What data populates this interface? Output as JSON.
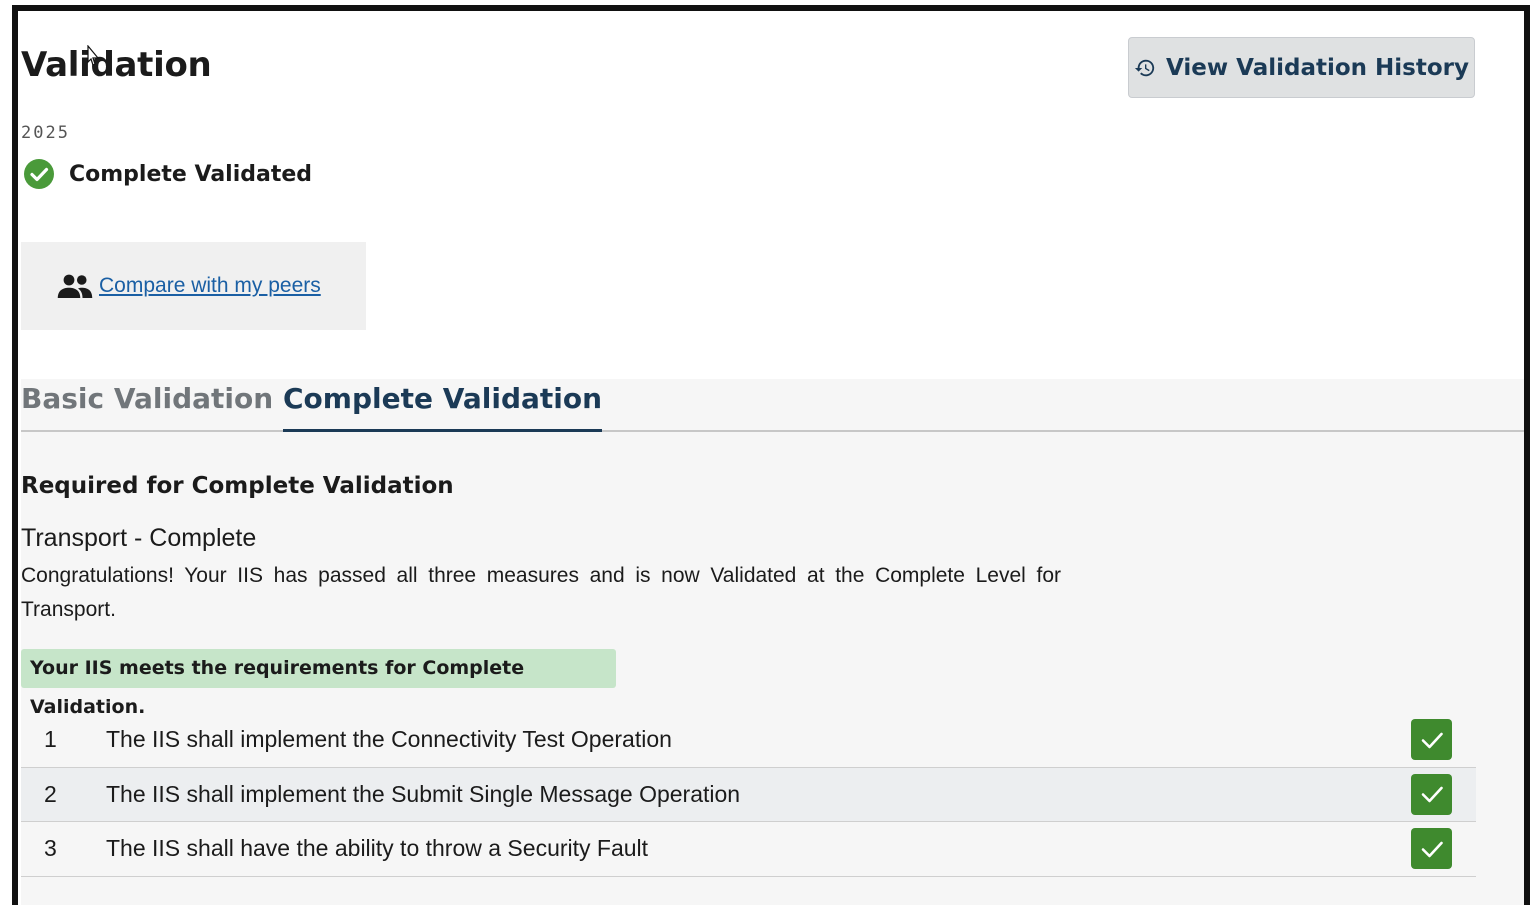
{
  "page": {
    "title": "Validation",
    "history_button": "View Validation History",
    "year": "2025",
    "status_label": "Complete Validated",
    "peers_link": "Compare with my peers"
  },
  "tabs": [
    {
      "label": "Basic Validation",
      "active": false
    },
    {
      "label": "Complete Validation",
      "active": true
    }
  ],
  "content": {
    "heading": "Required for Complete Validation",
    "measure_title": "Transport - Complete",
    "measure_description": "Congratulations! Your IIS has passed all three measures and is now Validated at the Complete Level for Transport.",
    "notice": "Your IIS meets the requirements for Complete Validation.",
    "requirements": [
      {
        "num": "1",
        "text": "The IIS shall implement the Connectivity Test Operation",
        "passed": true
      },
      {
        "num": "2",
        "text": "The IIS shall implement the Submit Single Message Operation",
        "passed": true
      },
      {
        "num": "3",
        "text": "The IIS shall have the ability to throw a Security Fault",
        "passed": true
      }
    ]
  },
  "icons": {
    "history": "history-icon",
    "status": "check-circle-icon",
    "peers": "people-icon",
    "check": "checkmark-icon"
  },
  "colors": {
    "success_green": "#3f8a2e",
    "status_green": "#4a9a3a",
    "notice_bg": "#c6e5c9",
    "link_blue": "#1a5fa4",
    "navy": "#1b3a56",
    "button_bg": "#dfe1e2"
  }
}
